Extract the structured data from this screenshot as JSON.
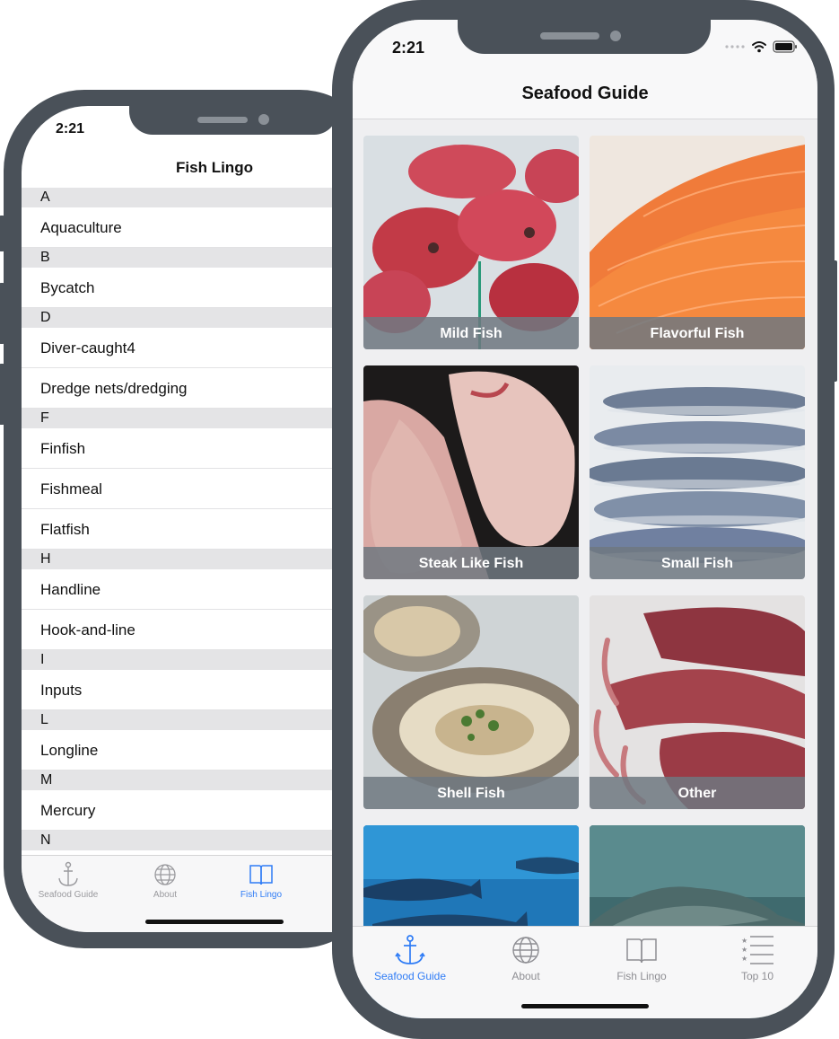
{
  "back_phone": {
    "time": "2:21",
    "title": "Fish Lingo",
    "sections": [
      {
        "letter": "A",
        "items": [
          "Aquaculture"
        ]
      },
      {
        "letter": "B",
        "items": [
          "Bycatch"
        ]
      },
      {
        "letter": "D",
        "items": [
          "Diver-caught4",
          "Dredge nets/dredging"
        ]
      },
      {
        "letter": "F",
        "items": [
          "Finfish",
          "Fishmeal",
          "Flatfish"
        ]
      },
      {
        "letter": "H",
        "items": [
          "Handline",
          "Hook-and-line"
        ]
      },
      {
        "letter": "I",
        "items": [
          "Inputs"
        ]
      },
      {
        "letter": "L",
        "items": [
          "Longline"
        ]
      },
      {
        "letter": "M",
        "items": [
          "Mercury"
        ]
      },
      {
        "letter": "N",
        "items": []
      }
    ],
    "tabs": [
      {
        "label": "Seafood Guide",
        "icon": "anchor-icon",
        "active": false
      },
      {
        "label": "About",
        "icon": "globe-icon",
        "active": false
      },
      {
        "label": "Fish Lingo",
        "icon": "book-icon",
        "active": true
      }
    ]
  },
  "front_phone": {
    "time": "2:21",
    "title": "Seafood Guide",
    "tiles": [
      {
        "label": "Mild Fish",
        "image": "red-snapper-on-ice"
      },
      {
        "label": "Flavorful Fish",
        "image": "salmon-fillet"
      },
      {
        "label": "Steak Like Fish",
        "image": "fish-steaks"
      },
      {
        "label": "Small Fish",
        "image": "sardines"
      },
      {
        "label": "Shell Fish",
        "image": "oysters"
      },
      {
        "label": "Other",
        "image": "squid"
      },
      {
        "label": "",
        "image": "tuna-underwater"
      },
      {
        "label": "",
        "image": "shark-underwater"
      }
    ],
    "tabs": [
      {
        "label": "Seafood Guide",
        "icon": "anchor-icon",
        "active": true
      },
      {
        "label": "About",
        "icon": "globe-icon",
        "active": false
      },
      {
        "label": "Fish Lingo",
        "icon": "book-icon",
        "active": false
      },
      {
        "label": "Top 10",
        "icon": "ranked-list-icon",
        "active": false
      }
    ]
  },
  "colors": {
    "accent": "#2f7cf6",
    "frame": "#4a5159",
    "section_bg": "#e4e4e6",
    "inactive_tab": "#8e8e93"
  }
}
